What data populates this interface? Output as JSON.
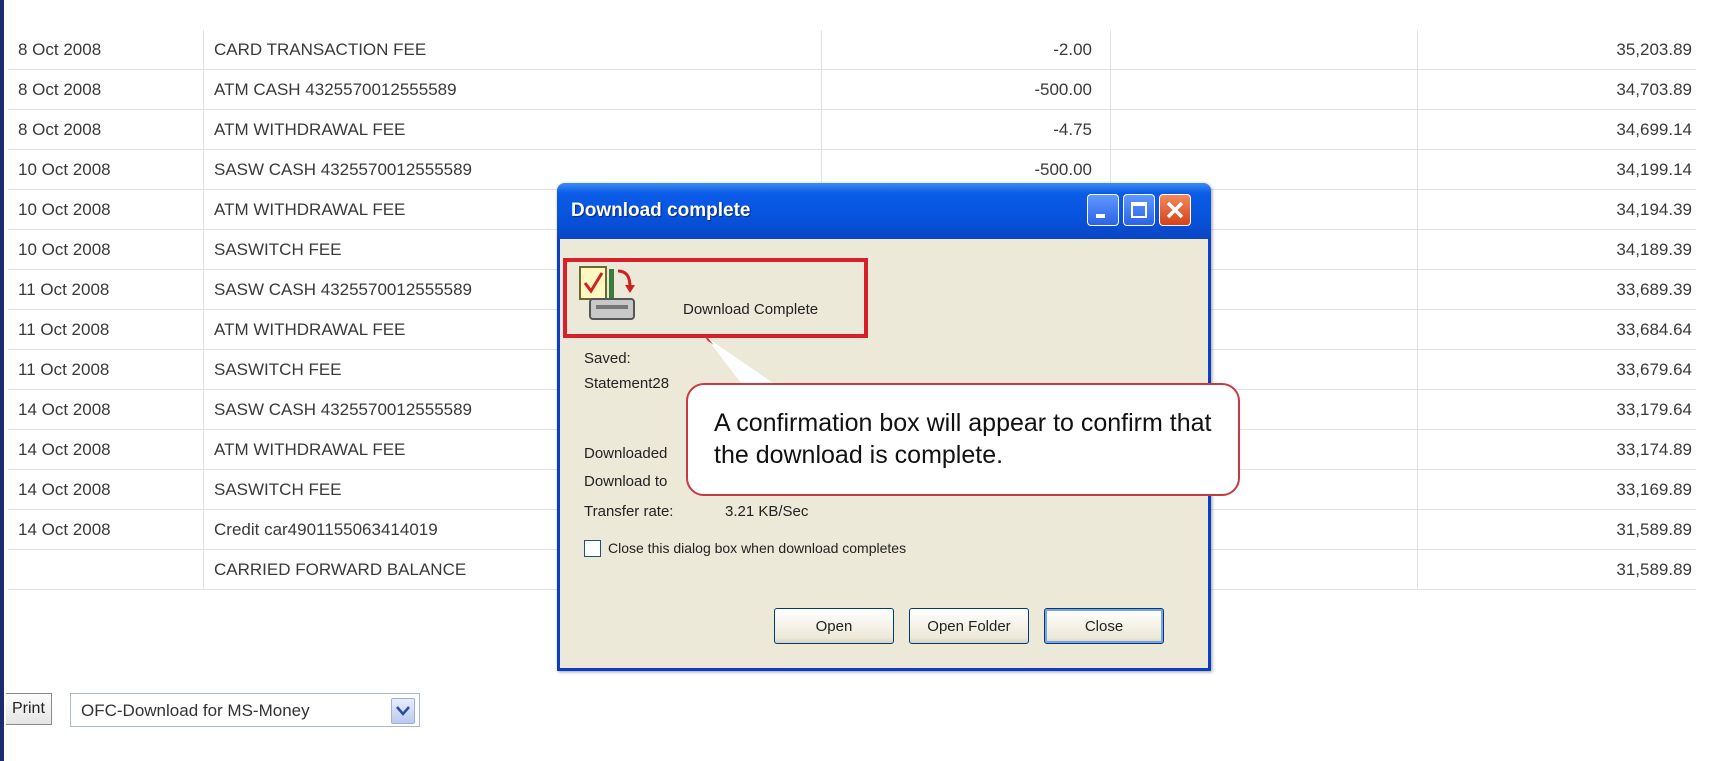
{
  "statement": {
    "rows": [
      {
        "date": "8 Oct 2008",
        "description": "CARD TRANSACTION FEE",
        "amount": "-2.00",
        "balance": "35,203.89"
      },
      {
        "date": "8 Oct 2008",
        "description": "ATM CASH 4325570012555589",
        "amount": "-500.00",
        "balance": "34,703.89"
      },
      {
        "date": "8 Oct 2008",
        "description": "ATM WITHDRAWAL FEE",
        "amount": "-4.75",
        "balance": "34,699.14"
      },
      {
        "date": "10 Oct 2008",
        "description": "SASW CASH 4325570012555589",
        "amount": "-500.00",
        "balance": "34,199.14"
      },
      {
        "date": "10 Oct 2008",
        "description": "ATM WITHDRAWAL FEE",
        "amount": "",
        "balance": "34,194.39"
      },
      {
        "date": "10 Oct 2008",
        "description": "SASWITCH FEE",
        "amount": "",
        "balance": "34,189.39"
      },
      {
        "date": "11 Oct 2008",
        "description": "SASW CASH 4325570012555589",
        "amount": "",
        "balance": "33,689.39"
      },
      {
        "date": "11 Oct 2008",
        "description": "ATM WITHDRAWAL FEE",
        "amount": "",
        "balance": "33,684.64"
      },
      {
        "date": "11 Oct 2008",
        "description": "SASWITCH FEE",
        "amount": "",
        "balance": "33,679.64"
      },
      {
        "date": "14 Oct 2008",
        "description": "SASW CASH 4325570012555589",
        "amount": "",
        "balance": "33,179.64"
      },
      {
        "date": "14 Oct 2008",
        "description": "ATM WITHDRAWAL FEE",
        "amount": "",
        "balance": "33,174.89"
      },
      {
        "date": "14 Oct 2008",
        "description": "SASWITCH FEE",
        "amount": "",
        "balance": "33,169.89"
      },
      {
        "date": "14 Oct 2008",
        "description": "Credit car4901155063414019",
        "amount": "",
        "balance": "31,589.89"
      },
      {
        "date": "",
        "description": "CARRIED FORWARD BALANCE",
        "amount": "",
        "balance": "31,589.89"
      }
    ]
  },
  "bottom": {
    "print_label": "Print",
    "download_select_value": "OFC-Download for MS-Money"
  },
  "dialog": {
    "title": "Download complete",
    "status": "Download Complete",
    "saved_label": "Saved:",
    "saved_value": "Statement28",
    "downloaded_label": "Downloaded",
    "download_to_label": "Download to",
    "transfer_rate_label": "Transfer rate:",
    "transfer_rate_value": "3.21 KB/Sec",
    "close_when_complete_label": "Close this dialog box when download completes",
    "open_label": "Open",
    "open_folder_label": "Open Folder",
    "close_label": "Close"
  },
  "callout": {
    "text": "A confirmation box will appear to confirm that the download is complete."
  },
  "colors": {
    "title_bar": "#0753dd",
    "highlight_red": "#d8202a",
    "dialog_bg": "#ece9d8"
  }
}
